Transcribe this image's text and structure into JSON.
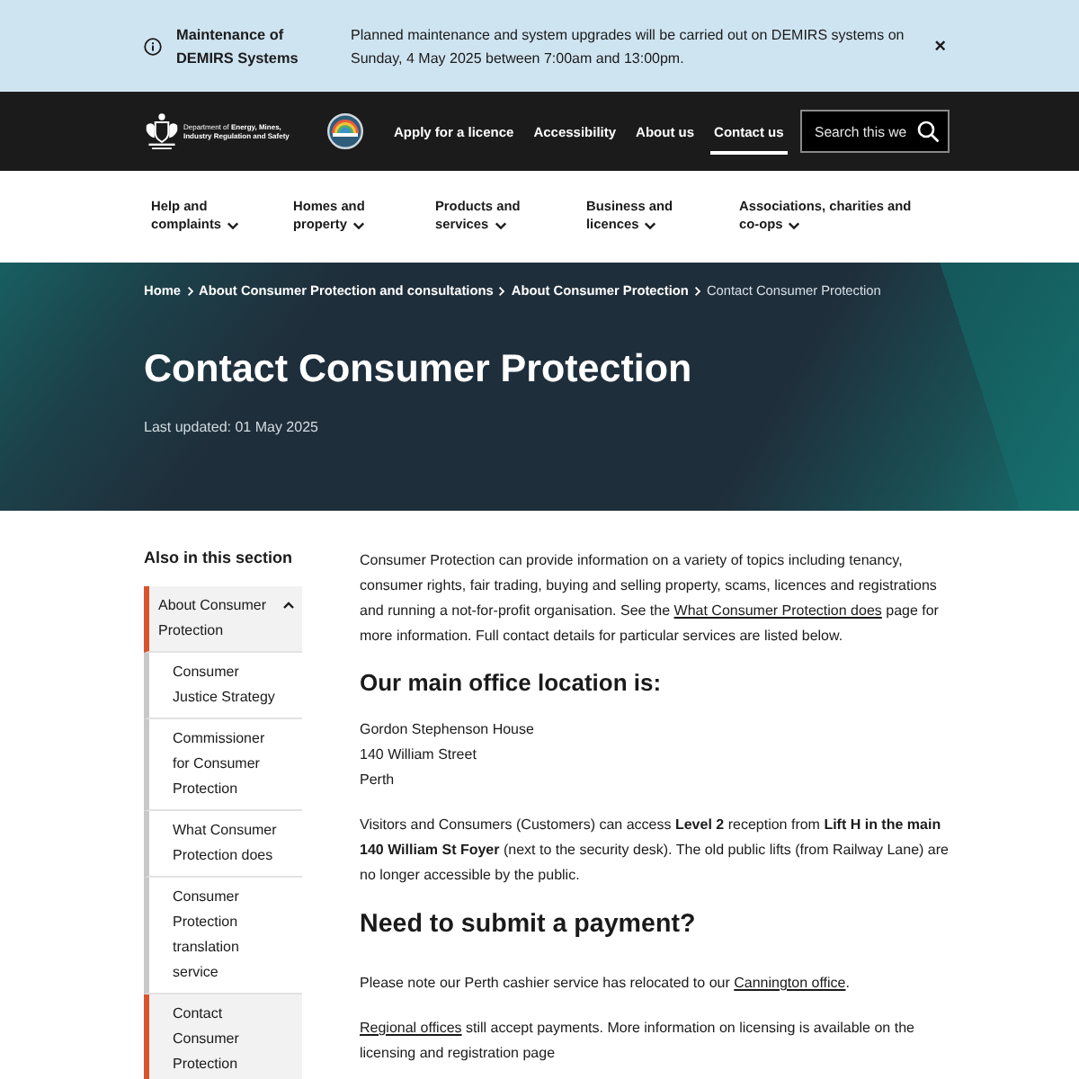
{
  "alert": {
    "title": "Maintenance of DEMIRS Systems",
    "message": "Planned maintenance and system upgrades will be carried out on DEMIRS systems on Sunday, 4 May 2025 between 7:00am and 13:00pm.",
    "close": "×"
  },
  "header": {
    "department": "Department of **Energy, Mines, Industry Regulation and Safety**",
    "links": [
      {
        "label": "Apply for a licence",
        "selected": false
      },
      {
        "label": "Accessibility",
        "selected": false
      },
      {
        "label": "About us",
        "selected": false
      },
      {
        "label": "Contact us",
        "selected": true
      }
    ],
    "search": {
      "placeholder": "Search this we"
    }
  },
  "main_nav": [
    {
      "label": "Help and complaints"
    },
    {
      "label": "Homes and property"
    },
    {
      "label": "Products and services"
    },
    {
      "label": "Business and licences"
    },
    {
      "label": "Associations, charities and co-ops"
    }
  ],
  "hero": {
    "breadcrumb": [
      {
        "label": "Home",
        "current": false
      },
      {
        "label": "About Consumer Protection and consultations",
        "current": false
      },
      {
        "label": "About Consumer Protection",
        "current": false
      },
      {
        "label": "Contact Consumer Protection",
        "current": true
      }
    ],
    "title": "Contact Consumer Protection",
    "updated": "Last updated: 01 May 2025"
  },
  "sidebar": {
    "heading": "Also in this section",
    "items": [
      {
        "label": "About Consumer Protection",
        "selected": true,
        "expanded": true,
        "children": [
          {
            "label": "Consumer Justice Strategy",
            "selected": false
          },
          {
            "label": "Commissioner for Consumer Protection",
            "selected": false
          },
          {
            "label": "What Consumer Protection does",
            "selected": false
          },
          {
            "label": "Consumer Protection translation service",
            "selected": false
          },
          {
            "label": "Contact Consumer Protection",
            "selected": true
          }
        ]
      }
    ]
  },
  "content": [
    {
      "kind": "paragraph",
      "parts": [
        {
          "kind": "text",
          "text": "Consumer Protection can provide information on a variety of topics including tenancy, consumer rights, fair trading, buying and selling property, scams, licences and registrations and running a not-for-profit organisation. See the "
        },
        {
          "kind": "link",
          "text": "What Consumer Protection does"
        },
        {
          "kind": "text",
          "text": " page for more information. Full contact details for particular services are listed below."
        }
      ]
    },
    {
      "kind": "subheading",
      "text": "Our main office location is:"
    },
    {
      "kind": "address",
      "lines": [
        "Gordon Stephenson House",
        "140 William Street",
        "Perth"
      ]
    },
    {
      "kind": "paragraph",
      "parts": [
        {
          "kind": "text",
          "text": "Visitors and Consumers (Customers) can access **Level 2** reception from **Lift H in the main 140 William St Foyer** (next to the security desk). The old public lifts (from Railway Lane) are no longer accessible by the public."
        }
      ]
    },
    {
      "kind": "heading",
      "text": "Need to submit a payment?"
    },
    {
      "kind": "paragraph",
      "parts": [
        {
          "kind": "text",
          "text": "Please note our Perth cashier service has relocated to our "
        },
        {
          "kind": "link",
          "text": "Cannington office"
        },
        {
          "kind": "text",
          "text": "."
        }
      ]
    },
    {
      "kind": "paragraph",
      "parts": [
        {
          "kind": "link",
          "text": "Regional offices"
        },
        {
          "kind": "text",
          "text": " still accept payments. More information on licensing is available on the licensing and registration page"
        }
      ]
    }
  ]
}
